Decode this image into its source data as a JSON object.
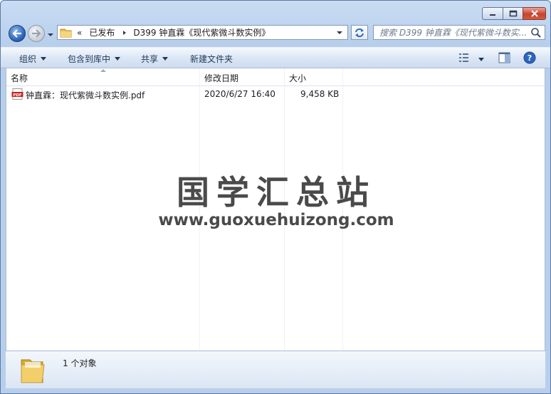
{
  "window": {
    "caption_buttons": [
      "minimize",
      "maximize",
      "close"
    ]
  },
  "address": {
    "overflow": "«",
    "crumbs": [
      "已发布",
      "D399 钟直霖《现代紫微斗数实例》"
    ]
  },
  "search": {
    "placeholder": "搜索 D399 钟直霖《现代紫微斗数实..."
  },
  "toolbar": {
    "organize": "组织",
    "include_library": "包含到库中",
    "share": "共享",
    "new_folder": "新建文件夹"
  },
  "columns": {
    "name": "名称",
    "modified": "修改日期",
    "size": "大小"
  },
  "files": [
    {
      "name": "钟直霖：现代紫微斗数实例.pdf",
      "modified": "2020/6/27 16:40",
      "size": "9,458 KB",
      "icon": "pdf-icon"
    }
  ],
  "watermark": {
    "title": "国学汇总站",
    "url": "www.guoxuehuizong.com"
  },
  "details": {
    "item_count": "1 个对象"
  },
  "colors": {
    "frame": "#b8cfec",
    "close_button": "#c8422c",
    "accent": "#1e395b"
  }
}
